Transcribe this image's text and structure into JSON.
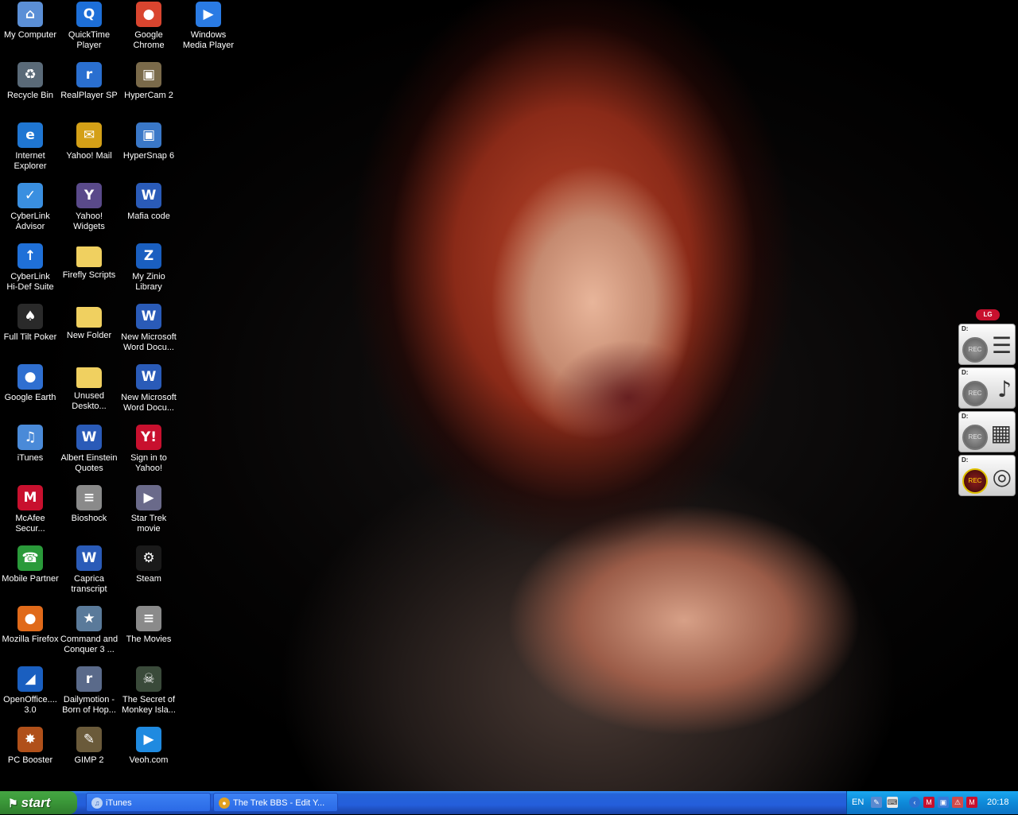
{
  "desktop": {
    "icons": [
      {
        "label": "My Computer",
        "icon": "my-computer-icon",
        "glyph": "⌂",
        "color": "#5b8fd6"
      },
      {
        "label": "QuickTime\nPlayer",
        "icon": "quicktime-icon",
        "glyph": "Q",
        "color": "#1d6fd8"
      },
      {
        "label": "Google\nChrome",
        "icon": "chrome-icon",
        "glyph": "●",
        "color": "#d9452f"
      },
      {
        "label": "Windows\nMedia Player",
        "icon": "media-player-icon",
        "glyph": "▶",
        "color": "#2a7be4"
      },
      {
        "label": "Recycle Bin",
        "icon": "recycle-bin-icon",
        "glyph": "♻",
        "color": "#5a6a78"
      },
      {
        "label": "RealPlayer SP",
        "icon": "realplayer-icon",
        "glyph": "r",
        "color": "#2a6fd0"
      },
      {
        "label": "HyperCam 2",
        "icon": "hypercam-icon",
        "glyph": "▣",
        "color": "#7a6a4a"
      },
      {
        "label": "Internet\nExplorer",
        "icon": "internet-explorer-icon",
        "glyph": "e",
        "color": "#1f76d2"
      },
      {
        "label": "Yahoo! Mail",
        "icon": "yahoo-mail-icon",
        "glyph": "✉",
        "color": "#d4a017"
      },
      {
        "label": "HyperSnap 6",
        "icon": "hypersnap-icon",
        "glyph": "▣",
        "color": "#3a78c8"
      },
      {
        "label": "CyberLink\nAdvisor",
        "icon": "cyberlink-advisor-icon",
        "glyph": "✓",
        "color": "#3a8fe0"
      },
      {
        "label": "Yahoo!\nWidgets",
        "icon": "yahoo-widgets-icon",
        "glyph": "Y",
        "color": "#5a4a8a"
      },
      {
        "label": "Mafia code",
        "icon": "word-document-icon",
        "glyph": "W",
        "color": "#2a5bb8"
      },
      {
        "label": "CyberLink\nHi-Def Suite",
        "icon": "cyberlink-hidef-icon",
        "glyph": "↑",
        "color": "#1f70d8"
      },
      {
        "label": "Firefly Scripts",
        "icon": "folder-icon",
        "glyph": "",
        "color": "#f0d060"
      },
      {
        "label": "My Zinio\nLibrary",
        "icon": "zinio-icon",
        "glyph": "Z",
        "color": "#1a5fc0"
      },
      {
        "label": "Full Tilt Poker",
        "icon": "full-tilt-poker-icon",
        "glyph": "♠",
        "color": "#2a2a2a"
      },
      {
        "label": "New Folder",
        "icon": "folder-icon",
        "glyph": "",
        "color": "#f0d060"
      },
      {
        "label": "New Microsoft\nWord Docu...",
        "icon": "word-document-icon",
        "glyph": "W",
        "color": "#2a5bb8"
      },
      {
        "label": "Google Earth",
        "icon": "google-earth-icon",
        "glyph": "●",
        "color": "#2f6fd0"
      },
      {
        "label": "Unused\nDeskto...",
        "icon": "folder-icon",
        "glyph": "",
        "color": "#f0d060"
      },
      {
        "label": "New Microsoft\nWord Docu...",
        "icon": "word-document-icon",
        "glyph": "W",
        "color": "#2a5bb8"
      },
      {
        "label": "iTunes",
        "icon": "itunes-icon",
        "glyph": "♫",
        "color": "#4a8ad8"
      },
      {
        "label": "Albert Einstein\nQuotes",
        "icon": "word-document-icon",
        "glyph": "W",
        "color": "#2a5bb8"
      },
      {
        "label": "Sign in to\nYahoo!",
        "icon": "yahoo-icon",
        "glyph": "Y!",
        "color": "#c8102e"
      },
      {
        "label": "McAfee\nSecur...",
        "icon": "mcafee-icon",
        "glyph": "M",
        "color": "#c8102e"
      },
      {
        "label": "Bioshock",
        "icon": "text-document-icon",
        "glyph": "≡",
        "color": "#8a8a8a"
      },
      {
        "label": "Star Trek\nmovie",
        "icon": "wmv-file-icon",
        "glyph": "▶",
        "color": "#6a6a8a"
      },
      {
        "label": "Mobile Partner",
        "icon": "mobile-partner-icon",
        "glyph": "☎",
        "color": "#2a9a3a"
      },
      {
        "label": "Caprica\ntranscript",
        "icon": "word-document-icon",
        "glyph": "W",
        "color": "#2a5bb8"
      },
      {
        "label": "Steam",
        "icon": "steam-icon",
        "glyph": "⚙",
        "color": "#1a1a1a"
      },
      {
        "label": "Mozilla Firefox",
        "icon": "firefox-icon",
        "glyph": "●",
        "color": "#e06a1a"
      },
      {
        "label": "Command and\nConquer 3 ...",
        "icon": "command-conquer-icon",
        "glyph": "★",
        "color": "#5a7a9a"
      },
      {
        "label": "The Movies",
        "icon": "text-document-icon",
        "glyph": "≡",
        "color": "#8a8a8a"
      },
      {
        "label": "OpenOffice....\n3.0",
        "icon": "openoffice-icon",
        "glyph": "◢",
        "color": "#1a5fc0"
      },
      {
        "label": "Dailymotion -\nBorn of Hop...",
        "icon": "realplayer-file-icon",
        "glyph": "r",
        "color": "#5a6a8a"
      },
      {
        "label": "The Secret of\nMonkey Isla...",
        "icon": "monkey-island-icon",
        "glyph": "☠",
        "color": "#3a4a3a"
      },
      {
        "label": "PC Booster",
        "icon": "pc-booster-icon",
        "glyph": "✸",
        "color": "#b0501a"
      },
      {
        "label": "GIMP 2",
        "icon": "gimp-icon",
        "glyph": "✎",
        "color": "#6a5a3a"
      },
      {
        "label": "Veoh.com",
        "icon": "veoh-icon",
        "glyph": "▶",
        "color": "#1f8ae0"
      }
    ]
  },
  "recorder": {
    "brand": "LG",
    "drives": [
      {
        "drive": "D:",
        "rec": "REC",
        "type_icon": "document-icon",
        "type_glyph": "☰",
        "active": false
      },
      {
        "drive": "D:",
        "rec": "REC",
        "type_icon": "music-note-icon",
        "type_glyph": "♪",
        "active": false
      },
      {
        "drive": "D:",
        "rec": "REC",
        "type_icon": "film-icon",
        "type_glyph": "▦",
        "active": false
      },
      {
        "drive": "D:",
        "rec": "REC",
        "type_icon": "disc-icon",
        "type_glyph": "◎",
        "active": true
      }
    ]
  },
  "taskbar": {
    "start_label": "start",
    "tasks": [
      {
        "label": "iTunes",
        "icon": "itunes-icon"
      },
      {
        "label": "The Trek BBS - Edit Y...",
        "icon": "chrome-icon"
      }
    ],
    "tray": {
      "language": "EN",
      "clock": "20:18"
    }
  }
}
